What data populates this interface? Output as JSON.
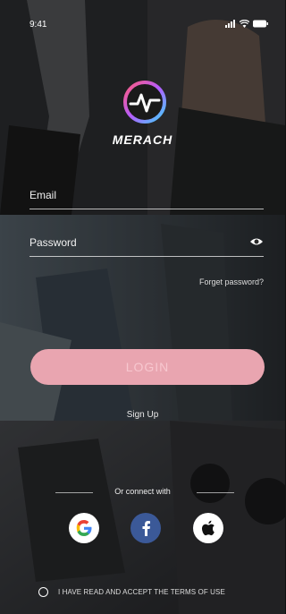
{
  "status_bar": {
    "time": "9:41"
  },
  "brand": {
    "name": "MERACH"
  },
  "form": {
    "email_placeholder": "Email",
    "password_placeholder": "Password",
    "forgot_label": "Forget password?"
  },
  "actions": {
    "login_label": "LOGIN",
    "signup_label": "Sign Up"
  },
  "social": {
    "divider_label": "Or connect with",
    "providers": [
      "google-icon",
      "facebook-icon",
      "apple-icon"
    ]
  },
  "terms": {
    "label": "I HAVE READ AND ACCEPT THE TERMS OF USE",
    "checked": false
  },
  "colors": {
    "login_button": "#e9a5b0",
    "facebook": "#3b5998"
  }
}
